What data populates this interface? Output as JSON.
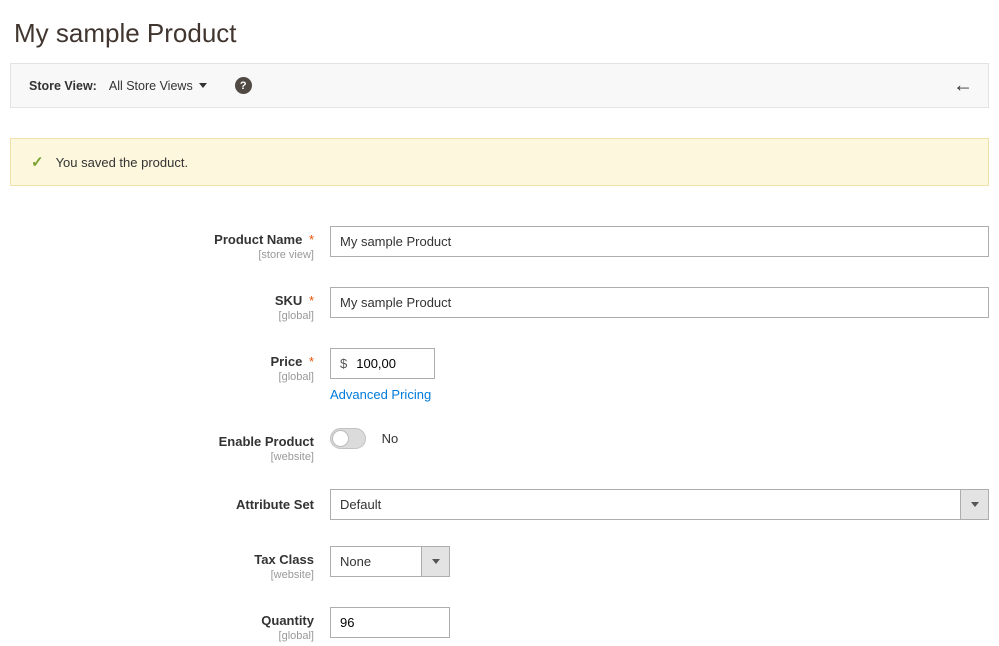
{
  "pageTitle": "My sample Product",
  "storeViewBar": {
    "label": "Store View:",
    "selected": "All Store Views",
    "helpGlyph": "?"
  },
  "successMessage": "You saved the product.",
  "fields": {
    "productName": {
      "label": "Product Name",
      "scope": "[store view]",
      "value": "My sample Product",
      "required": "*"
    },
    "sku": {
      "label": "SKU",
      "scope": "[global]",
      "value": "My sample Product",
      "required": "*"
    },
    "price": {
      "label": "Price",
      "scope": "[global]",
      "currency": "$",
      "value": "100,00",
      "required": "*",
      "advancedLink": "Advanced Pricing"
    },
    "enableProduct": {
      "label": "Enable Product",
      "scope": "[website]",
      "state": "No"
    },
    "attributeSet": {
      "label": "Attribute Set",
      "value": "Default"
    },
    "taxClass": {
      "label": "Tax Class",
      "scope": "[website]",
      "value": "None"
    },
    "quantity": {
      "label": "Quantity",
      "scope": "[global]",
      "value": "96"
    }
  }
}
